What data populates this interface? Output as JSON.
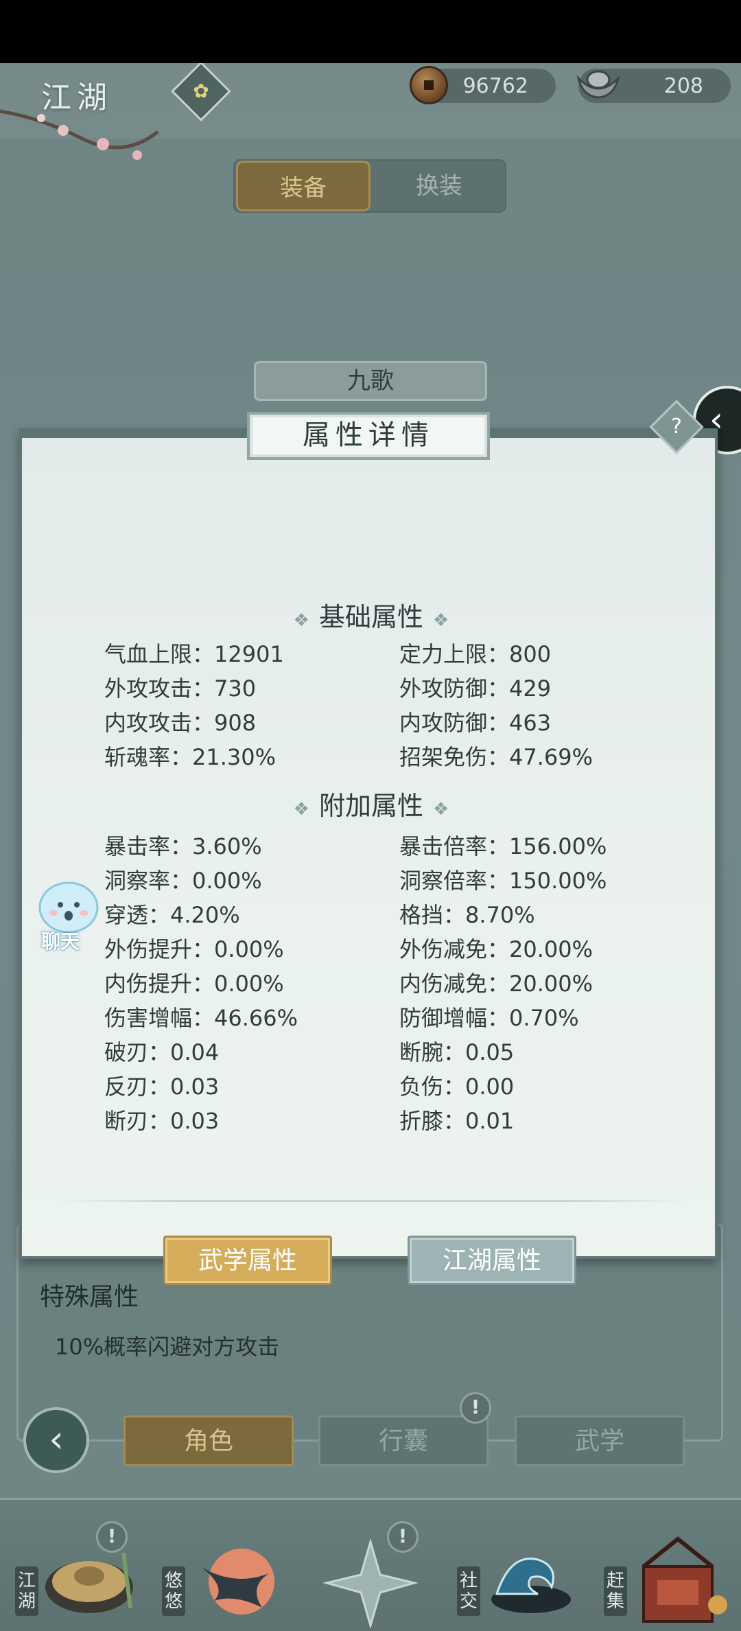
{
  "header": {
    "brand": "江湖",
    "coins": "96762",
    "ingots": "208"
  },
  "tabs": {
    "equip": "装备",
    "swap": "换装"
  },
  "character_name": "九歌",
  "help_label": "?",
  "panel": {
    "title": "属性详情",
    "basic_title": "基础属性",
    "extra_title": "附加属性",
    "basic_stats": [
      "气血上限：12901",
      "定力上限：800",
      "外攻攻击：730",
      "外攻防御：429",
      "内攻攻击：908",
      "内攻防御：463",
      "斩魂率：21.30%",
      "招架免伤：47.69%"
    ],
    "extra_stats": [
      "暴击率：3.60%",
      "暴击倍率：156.00%",
      "洞察率：0.00%",
      "洞察倍率：150.00%",
      "穿透：4.20%",
      "格挡：8.70%",
      "外伤提升：0.00%",
      "外伤减免：20.00%",
      "内伤提升：0.00%",
      "内伤减免：20.00%",
      "伤害增幅：46.66%",
      "防御增幅：0.70%",
      "破刃：0.04",
      "断腕：0.05",
      "反刃：0.03",
      "负伤：0.00",
      "断刃：0.03",
      "折膝：0.01"
    ],
    "btn_martial": "武学属性",
    "btn_jianghu": "江湖属性"
  },
  "chat_label": "聊天",
  "special": {
    "title": "特殊属性",
    "text": "10%概率闪避对方攻击"
  },
  "nav": {
    "role": "角色",
    "bag": "行囊",
    "martial": "武学",
    "alert": "!"
  },
  "bottom": {
    "jianghu": "江湖",
    "youyou": "悠悠",
    "social": "社交",
    "market": "赶集"
  }
}
